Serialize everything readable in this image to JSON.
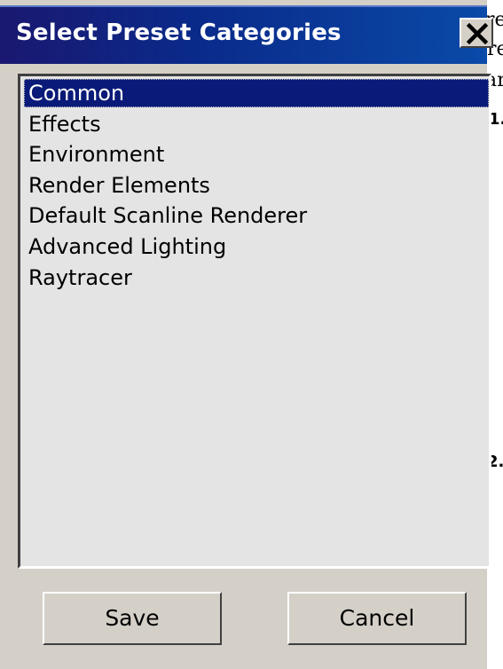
{
  "dialog": {
    "title": "Select Preset Categories",
    "close_icon": "close-icon"
  },
  "list": {
    "items": [
      {
        "label": "Common",
        "selected": true
      },
      {
        "label": "Effects",
        "selected": false
      },
      {
        "label": "Environment",
        "selected": false
      },
      {
        "label": "Render Elements",
        "selected": false
      },
      {
        "label": "Default Scanline Renderer",
        "selected": false
      },
      {
        "label": "Advanced Lighting",
        "selected": false
      },
      {
        "label": "Raytracer",
        "selected": false
      }
    ]
  },
  "buttons": {
    "save_label": "Save",
    "cancel_label": "Cancel"
  },
  "background": {
    "text_1": "re",
    "text_2": "re",
    "text_3": "ar",
    "num_1": "1.",
    "num_2": "2."
  },
  "colors": {
    "titlebar": "#0a2a8a",
    "selection": "#0a1a78",
    "face": "#d4d0c8",
    "list_bg": "#e4e4e4"
  }
}
